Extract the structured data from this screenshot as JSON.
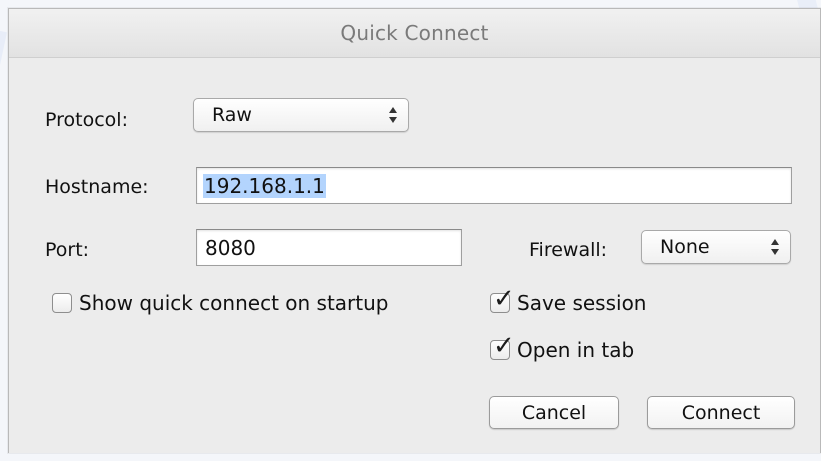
{
  "window": {
    "title": "Quick Connect"
  },
  "protocol": {
    "label": "Protocol:",
    "value": "Raw"
  },
  "hostname": {
    "label": "Hostname:",
    "value": "192.168.1.1"
  },
  "port": {
    "label": "Port:",
    "value": "8080"
  },
  "firewall": {
    "label": "Firewall:",
    "value": "None"
  },
  "options": {
    "show_on_startup": {
      "label": "Show quick connect on startup",
      "checked": false
    },
    "save_session": {
      "label": "Save session",
      "checked": true
    },
    "open_in_tab": {
      "label": "Open in tab",
      "checked": true
    }
  },
  "buttons": {
    "cancel": "Cancel",
    "connect": "Connect"
  },
  "colors": {
    "selection": "#b3d4fd",
    "window_bg": "#ececec",
    "title_text": "#7a7a7a"
  }
}
